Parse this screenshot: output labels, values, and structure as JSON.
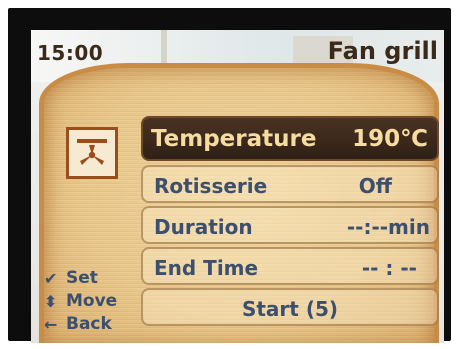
{
  "status": {
    "time": "15:00",
    "mode": "Fan grill"
  },
  "mode_icon": "fan-grill-icon",
  "menu": [
    {
      "label": "Temperature",
      "value": "190℃",
      "selected": true
    },
    {
      "label": "Rotisserie",
      "value": "Off"
    },
    {
      "label": "Duration",
      "value": "--:--min"
    },
    {
      "label": "End Time",
      "value": "-- : --"
    },
    {
      "label": "Start (5)",
      "value": ""
    }
  ],
  "hints": [
    {
      "icon": "checkmark-icon",
      "label": "Set"
    },
    {
      "icon": "up-down-arrow-icon",
      "label": "Move"
    },
    {
      "icon": "left-arrow-icon",
      "label": "Back"
    }
  ],
  "colors": {
    "selected_bg": "#3a281b",
    "selected_text": "#f7dca2",
    "text": "#3d4f6e",
    "bread": "#e8c689"
  }
}
